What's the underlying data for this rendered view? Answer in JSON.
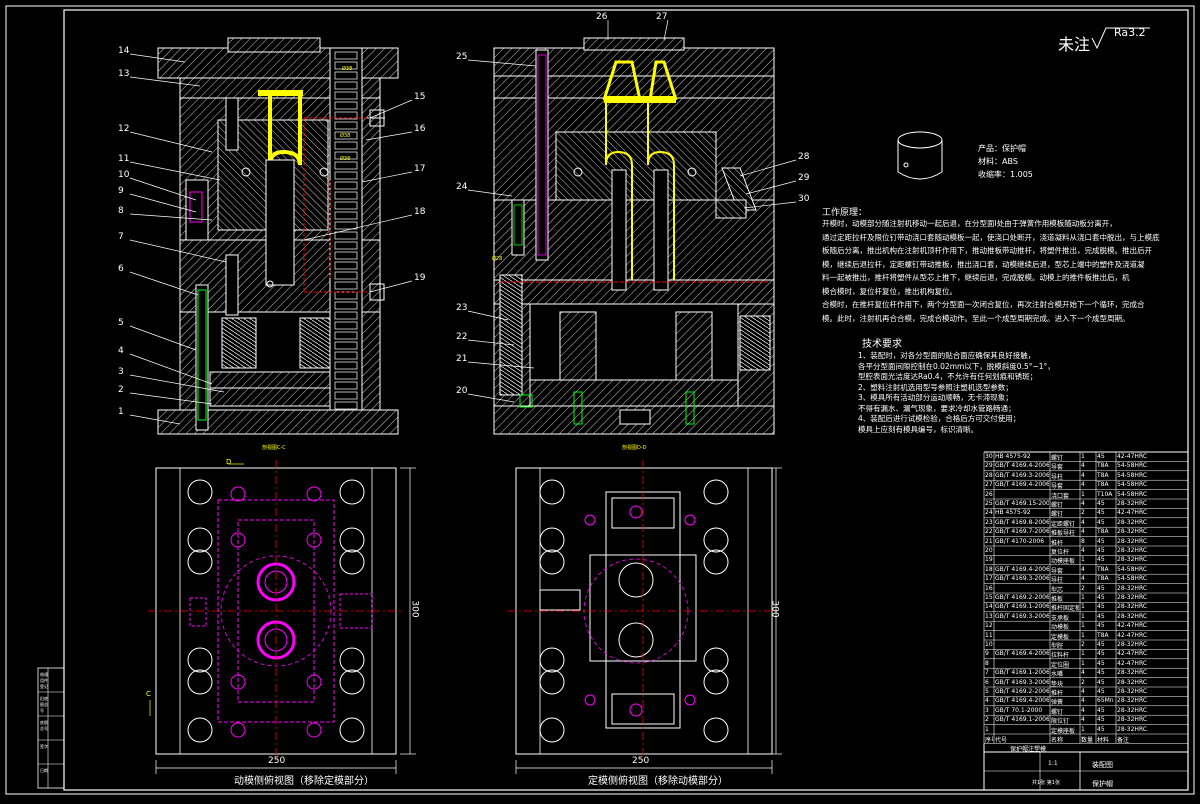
{
  "drawing": {
    "surface_note": {
      "label": "未注",
      "ra": "Ra3.2"
    },
    "product_info": {
      "product": "产品：保护帽",
      "material": "材料：ABS",
      "shrinkage": "收缩率：1.005"
    },
    "work_process": {
      "title": "工作原理：",
      "lines": [
        "开模时，动模部分随注射机移动一起后退，在分型面Ⅰ处由于弹簧作用模板随动板分离开，",
        "通过定距拉杆及限位钉带动浇口套随动模板一起，使浇口处断开，浇道凝料从浇口套中脱出，与上模底",
        "板随后分离，推出机构在注射机顶杆作用下，推动推板带动推杆，将塑件推出，完成脱模。推出后开",
        "模，继续后退拉杆，定距螺钉带动推板，推出浇口套，动模继续后退，型芯上端中的塑件及浇道凝",
        "料一起被推出，推杆将塑件从型芯上推下，继续后退，完成脱模。动模上的推件板推出后，机",
        "模合模时，复位杆复位，推出机构复位。",
        "合模时，在推杆复位杆作用下，两个分型面一次闭合复位，再次注射合模开始下一个循环，完成合",
        "模。此时，注射机再合合模，完成合模动作。至此一个成型周期完成。进入下一个成型周期。"
      ]
    },
    "tech_requirements": {
      "title": "技术要求",
      "lines": [
        "1、装配时，对各分型面的贴合面应确保其良好接触，",
        "各平分型面间隙控制在0.02mm以下，脱模斜度0.5°~1°，",
        "型腔表面光洁度达Ra0.4，不允许有任何划痕和锈斑；",
        "2、塑料注射机选用型号参照注塑机选型参数；",
        "3、模具所有活动部分运动顺畅，无卡滞现象；",
        "不得有漏水、漏气现象，要求冷却水管路畅通；",
        "4、装配后进行试模检验，合格后方可交付使用；",
        "模具上应刻有模具编号，标识清晰。"
      ]
    },
    "view_labels": {
      "section_c": "剖视图C-C",
      "section_d": "剖视图D-D",
      "moving_plan": "动模侧俯视图（移除定模部分）",
      "fixed_plan": "定模侧俯视图（移除动模部分）"
    },
    "balloons_left": [
      "14",
      "13",
      "15",
      "12",
      "16",
      "11",
      "10",
      "17",
      "9",
      "8",
      "18",
      "7",
      "6",
      "19",
      "5",
      "4",
      "3",
      "2",
      "1"
    ],
    "balloons_right": [
      "26",
      "27",
      "25",
      "28",
      "29",
      "24",
      "30",
      "23",
      "22",
      "21",
      "20"
    ],
    "section_tiny_labels": [
      "Ø38",
      "Ø38",
      "Ø38",
      "Ø28"
    ],
    "dimensions": {
      "left_width": "250",
      "left_height": "300",
      "right_width": "250",
      "right_height": "300",
      "section_mark_c": "C",
      "section_mark_d": "D"
    },
    "bom": {
      "rows": [
        [
          "30",
          "HB 4575-92",
          "螺钉",
          "1",
          "45",
          "42-47HRC"
        ],
        [
          "29",
          "GB/T 4169.4-2006",
          "导套",
          "4",
          "T8A",
          "54-58HRC"
        ],
        [
          "28",
          "GB/T 4169.3-2006",
          "导柱",
          "4",
          "T8A",
          "54-58HRC"
        ],
        [
          "27",
          "GB/T 4169.4-2006",
          "导套",
          "4",
          "T8A",
          "54-58HRC"
        ],
        [
          "26",
          "",
          "浇口套",
          "1",
          "T10A",
          "54-58HRC"
        ],
        [
          "25",
          "GB/T 4169.15-2006",
          "螺钉",
          "4",
          "45",
          "28-32HRC"
        ],
        [
          "24",
          "HB 4575-92",
          "螺钉",
          "2",
          "45",
          "42-47HRC"
        ],
        [
          "23",
          "GB/T 4169.8-2006",
          "定距螺钉",
          "4",
          "45",
          "28-32HRC"
        ],
        [
          "22",
          "GB/T 4169.7-2006",
          "推板导柱",
          "4",
          "T8A",
          "28-32HRC"
        ],
        [
          "21",
          "GB/T 4170-2006",
          "推杆",
          "8",
          "45",
          "28-32HRC"
        ],
        [
          "20",
          "",
          "复位杆",
          "4",
          "45",
          "28-32HRC"
        ],
        [
          "19",
          "",
          "动模座板",
          "1",
          "45",
          "28-32HRC"
        ],
        [
          "18",
          "GB/T 4169.4-2006",
          "导套",
          "4",
          "T8A",
          "54-58HRC"
        ],
        [
          "17",
          "GB/T 4169.3-2006",
          "导柱",
          "4",
          "T8A",
          "54-58HRC"
        ],
        [
          "16",
          "",
          "型芯",
          "2",
          "45",
          "28-32HRC"
        ],
        [
          "15",
          "GB/T 4169.2-2006",
          "推板",
          "1",
          "45",
          "28-32HRC"
        ],
        [
          "14",
          "GB/T 4169.1-2006",
          "推杆固定板",
          "1",
          "45",
          "28-32HRC"
        ],
        [
          "13",
          "GB/T 4169.3-2006",
          "支承板",
          "1",
          "45",
          "28-32HRC"
        ],
        [
          "12",
          "",
          "动模板",
          "1",
          "45",
          "42-47HRC"
        ],
        [
          "11",
          "",
          "定模板",
          "1",
          "T8A",
          "42-47HRC"
        ],
        [
          "10",
          "",
          "型腔",
          "2",
          "45",
          "28-32HRC"
        ],
        [
          "9",
          "GB/T 4169.4-2006",
          "拉料杆",
          "1",
          "45",
          "42-47HRC"
        ],
        [
          "8",
          "",
          "定位圈",
          "1",
          "45",
          "42-47HRC"
        ],
        [
          "7",
          "GB/T 4169.1-2006",
          "水嘴",
          "4",
          "45",
          "28-32HRC"
        ],
        [
          "6",
          "GB/T 4169.3-2006",
          "垫块",
          "2",
          "45",
          "28-32HRC"
        ],
        [
          "5",
          "GB/T 4169.2-2006",
          "推杆",
          "4",
          "45",
          "28-32HRC"
        ],
        [
          "4",
          "GB/T 4169.4-2006",
          "弹簧",
          "4",
          "65Mn",
          "28-32HRC"
        ],
        [
          "3",
          "GB/T 70.1-2000",
          "螺钉",
          "4",
          "45",
          "28-32HRC"
        ],
        [
          "2",
          "GB/T 4169.1-2006",
          "限位钉",
          "4",
          "45",
          "28-32HRC"
        ],
        [
          "1",
          "",
          "定模座板",
          "1",
          "45",
          "28-32HRC"
        ]
      ],
      "header": [
        "序号",
        "代号",
        "名称",
        "数量",
        "材料",
        "备注"
      ],
      "assembly_label": "保护帽注塑模",
      "title_block": {
        "drawing_name": "装配图",
        "product_name": "保护帽",
        "scale": "1:1",
        "sheet": "共1张 第1张"
      }
    },
    "side_stamp": [
      "借通用件登记",
      "旧底图总号",
      "底图总号",
      "签字",
      "日期"
    ]
  }
}
